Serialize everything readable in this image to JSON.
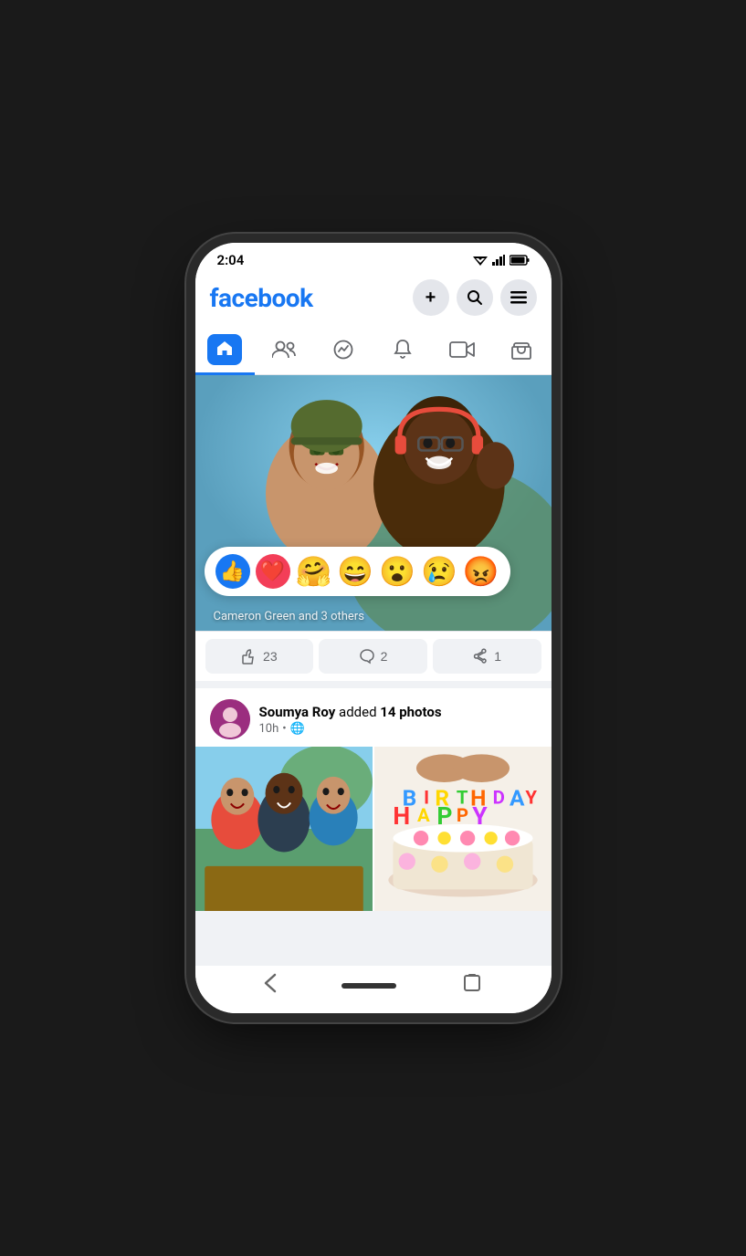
{
  "statusBar": {
    "time": "2:04",
    "wifi": "▲",
    "signal": "▲",
    "battery": "▮"
  },
  "header": {
    "logo": "facebook",
    "addLabel": "+",
    "searchLabel": "🔍",
    "menuLabel": "☰"
  },
  "nav": {
    "items": [
      {
        "id": "home",
        "label": "🏠",
        "active": true
      },
      {
        "id": "friends",
        "label": "👥",
        "active": false
      },
      {
        "id": "messenger",
        "label": "💬",
        "active": false
      },
      {
        "id": "notifications",
        "label": "🔔",
        "active": false
      },
      {
        "id": "video",
        "label": "📺",
        "active": false
      },
      {
        "id": "marketplace",
        "label": "🏪",
        "active": false
      }
    ]
  },
  "posts": [
    {
      "id": "post1",
      "reactions": {
        "items": [
          "👍",
          "❤️",
          "🤗",
          "😄",
          "😮",
          "😢",
          "😡"
        ],
        "likesText": "Cameron Green and 3 others"
      },
      "actions": [
        {
          "id": "like",
          "icon": "👍",
          "count": "23"
        },
        {
          "id": "comment",
          "icon": "💬",
          "count": "2"
        },
        {
          "id": "share",
          "icon": "↪",
          "count": "1"
        }
      ]
    },
    {
      "id": "post2",
      "authorName": "Soumya Roy",
      "actionText": "added",
      "photoCount": "14 photos",
      "timeAgo": "10h",
      "globe": "🌐",
      "photos": [
        "friends_selfie",
        "birthday_cake"
      ]
    }
  ],
  "bottomNav": {
    "back": "‹",
    "home": "",
    "rotate": "⟳"
  }
}
